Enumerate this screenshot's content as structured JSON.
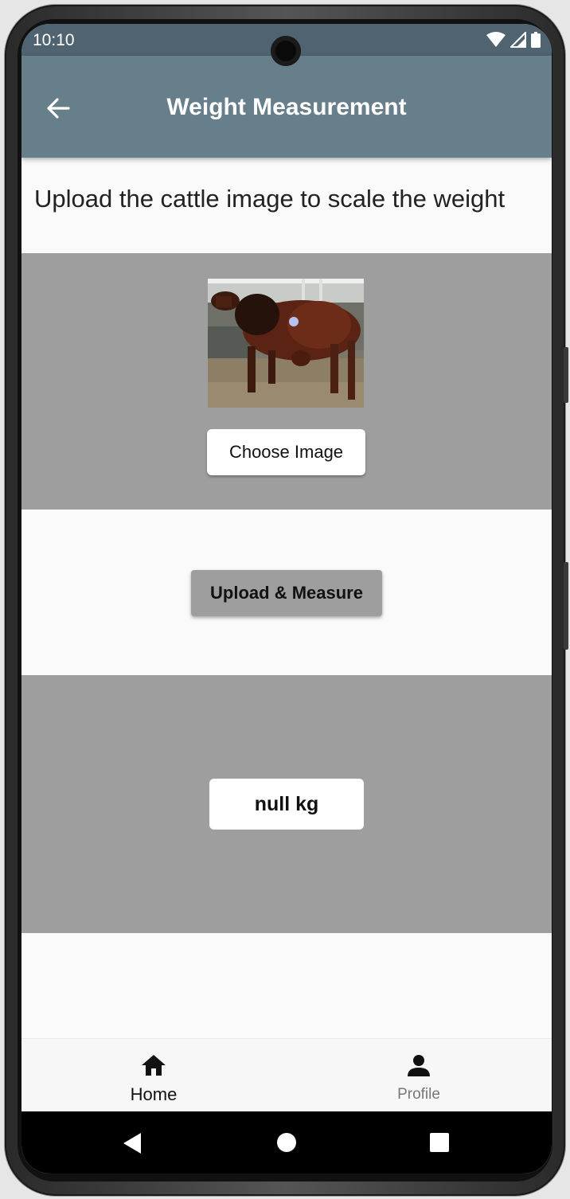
{
  "status_bar": {
    "time": "10:10",
    "icons": [
      "wifi-icon",
      "cell-signal-icon",
      "battery-icon"
    ]
  },
  "app_bar": {
    "title": "Weight Measurement",
    "back_icon": "arrow-back-icon"
  },
  "instruction": "Upload the cattle image to scale the weight",
  "image_section": {
    "photo": "cow-photo",
    "choose_label": "Choose Image"
  },
  "upload_section": {
    "button_label": "Upload & Measure"
  },
  "result": {
    "value": "null kg"
  },
  "bottom_nav": {
    "items": [
      {
        "label": "Home",
        "icon": "home-icon",
        "active": true
      },
      {
        "label": "Profile",
        "icon": "person-icon",
        "active": false
      }
    ]
  },
  "system_nav": [
    "back-triangle-icon",
    "home-circle-icon",
    "recents-square-icon"
  ],
  "colors": {
    "app_bar": "#677e8b",
    "status_bar": "#4f6470",
    "section_gray": "#9e9e9e",
    "background": "#fafafa"
  }
}
